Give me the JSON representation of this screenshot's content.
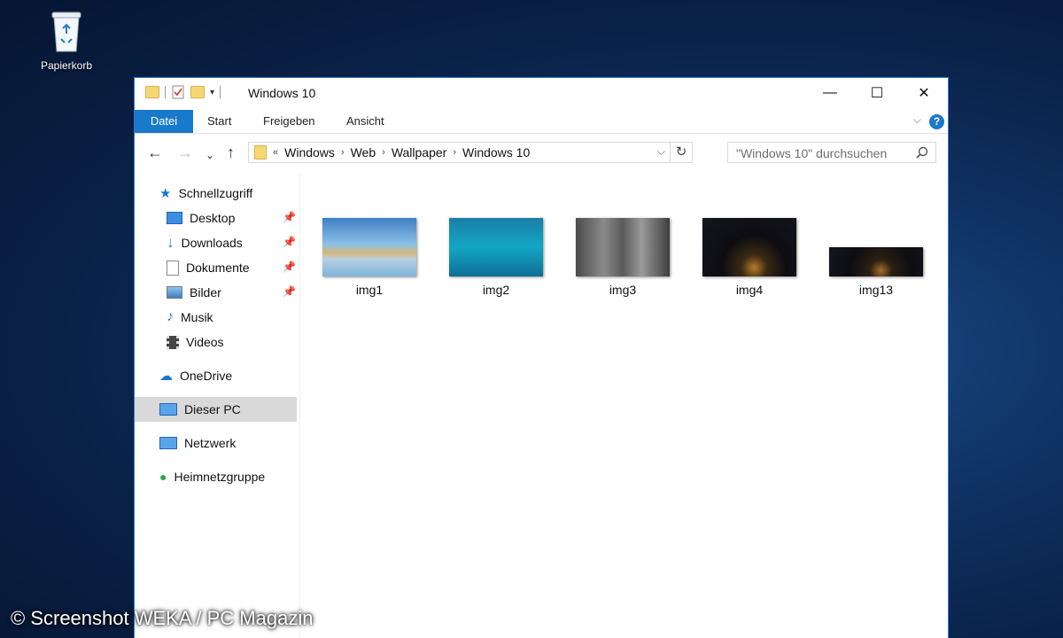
{
  "desktop": {
    "recycle_bin_label": "Papierkorb"
  },
  "watermark": "© Screenshot WEKA / PC Magazin",
  "window": {
    "title": "Windows 10",
    "controls": {
      "minimize": "—",
      "maximize": "☐",
      "close": "✕"
    }
  },
  "ribbon": {
    "tabs": [
      "Datei",
      "Start",
      "Freigeben",
      "Ansicht"
    ],
    "help": "?"
  },
  "address": {
    "overflow": "«",
    "crumbs": [
      "Windows",
      "Web",
      "Wallpaper",
      "Windows 10"
    ]
  },
  "search": {
    "placeholder": "\"Windows 10\" durchsuchen"
  },
  "nav": {
    "quick_access": "Schnellzugriff",
    "desktop": "Desktop",
    "downloads": "Downloads",
    "documents": "Dokumente",
    "pictures": "Bilder",
    "music": "Musik",
    "videos": "Videos",
    "onedrive": "OneDrive",
    "this_pc": "Dieser PC",
    "network": "Netzwerk",
    "homegroup": "Heimnetzgruppe"
  },
  "files": [
    {
      "name": "img1"
    },
    {
      "name": "img2"
    },
    {
      "name": "img3"
    },
    {
      "name": "img4"
    },
    {
      "name": "img13"
    }
  ],
  "colors": {
    "accent": "#1979ca",
    "selected_nav": "#d9d9d9",
    "window_border": "#2b7bd8"
  }
}
